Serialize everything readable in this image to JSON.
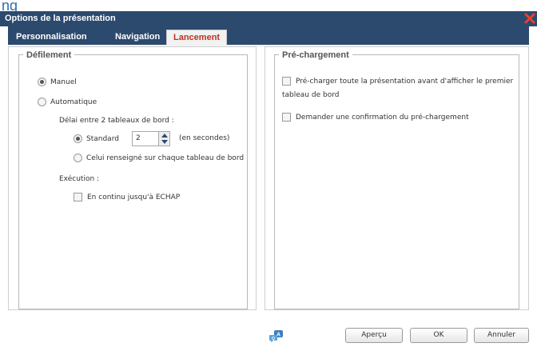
{
  "window": {
    "title": "Options de la présentation",
    "close_icon": "close-x-icon",
    "accent_color": "#2c4a6e",
    "close_color": "#e8402f"
  },
  "header_logo_text": "ng",
  "tabs": [
    {
      "label": "Personnalisation",
      "active": false
    },
    {
      "label": "Navigation",
      "active": false
    },
    {
      "label": "Lancement",
      "active": true
    }
  ],
  "defilement": {
    "legend": "Défilement",
    "manuel_label": "Manuel",
    "manuel_checked": true,
    "auto_label": "Automatique",
    "auto_checked": false,
    "delai_label": "Délai entre 2 tableaux de bord :",
    "standard_label": "Standard",
    "standard_checked": true,
    "standard_value": "2",
    "seconds_label": "(en secondes)",
    "celui_label": "Celui renseigné sur chaque tableau de bord",
    "celui_checked": false,
    "execution_label": "Exécution :",
    "continu_label": "En continu jusqu'à ECHAP",
    "continu_checked": false
  },
  "prechargement": {
    "legend": "Pré-chargement",
    "precharger_label": "Pré-charger toute la présentation avant d'afficher le premier",
    "precharger_label_line2": "tableau de bord",
    "precharger_checked": false,
    "confirmation_label": "Demander une confirmation du pré-chargement",
    "confirmation_checked": false
  },
  "footer": {
    "help_icon": "chat-help-icon",
    "preview_label": "Aperçu",
    "ok_label": "OK",
    "cancel_label": "Annuler"
  }
}
